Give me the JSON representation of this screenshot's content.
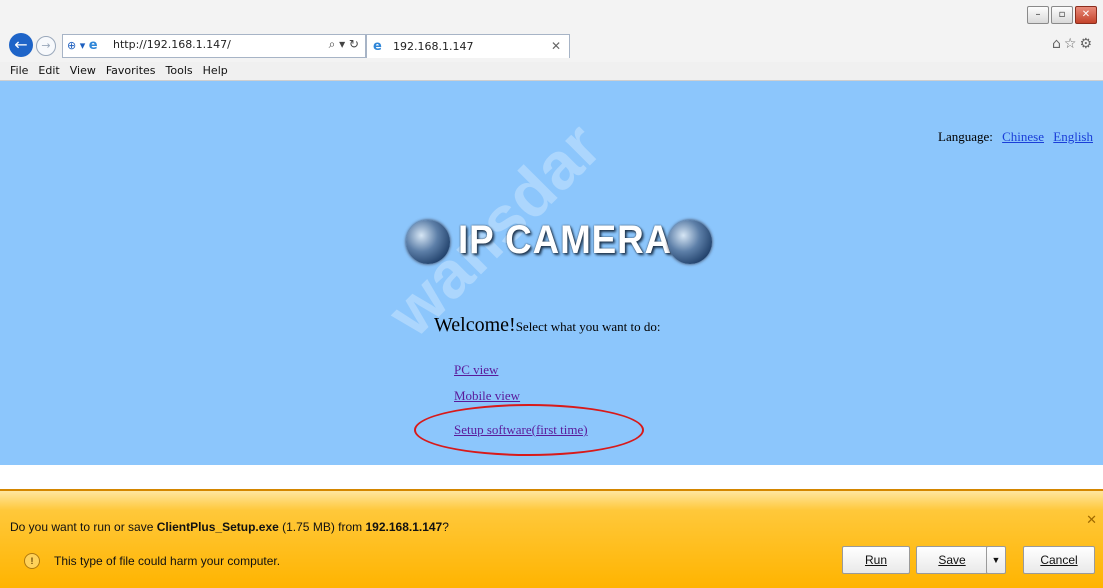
{
  "browser": {
    "url": "http://192.168.1.147/",
    "tab_title": "192.168.1.147",
    "window_controls": [
      "minimize",
      "maximize",
      "close"
    ],
    "menu": [
      "File",
      "Edit",
      "View",
      "Favorites",
      "Tools",
      "Help"
    ]
  },
  "page": {
    "language_label": "Language:",
    "languages": [
      "Chinese",
      "English"
    ],
    "logo_text": "IP CAMERA",
    "welcome_big": "Welcome!",
    "welcome_small": "Select what you want to do:",
    "links": [
      "PC view",
      "Mobile view",
      "Setup software(first time)"
    ],
    "watermark": "wansdar",
    "colors": {
      "background": "#8cc6fc",
      "link": "#5a1a9a",
      "highlight_oval": "#d81a1a"
    }
  },
  "download": {
    "question_prefix": "Do you want to run or save ",
    "file_name": "ClientPlus_Setup.exe",
    "file_size": " (1.75 MB) from ",
    "source": "192.168.1.147",
    "question_suffix": "?",
    "warning": "This type of file could harm your computer.",
    "buttons": {
      "run": "Run",
      "save": "Save",
      "cancel": "Cancel"
    },
    "colors": {
      "bar": "#ffb400"
    }
  }
}
